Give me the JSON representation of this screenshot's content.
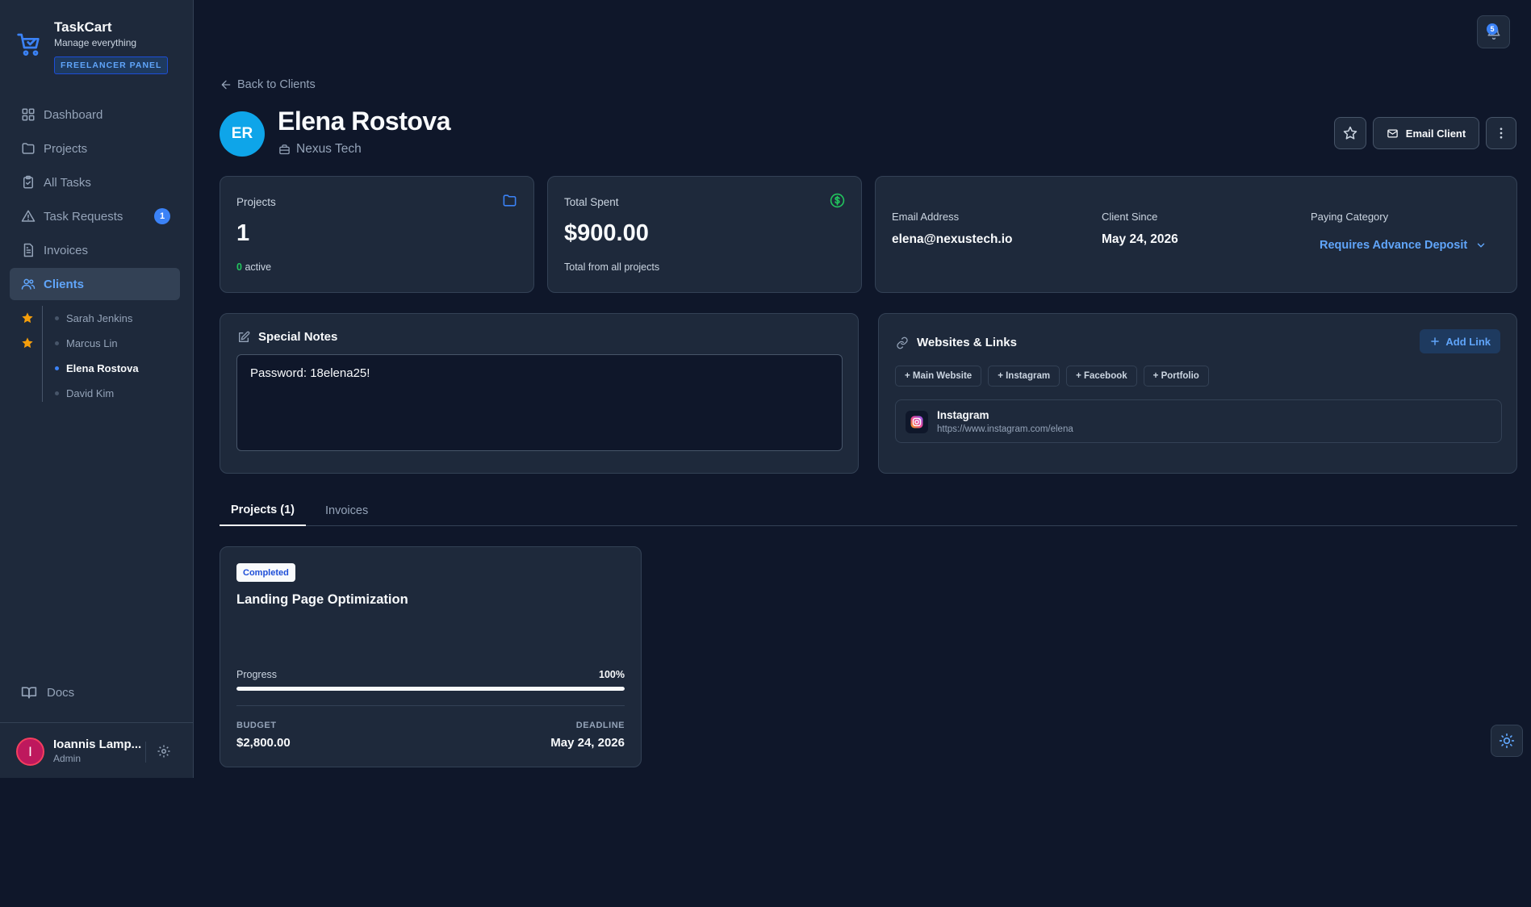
{
  "brand": {
    "name": "TaskCart",
    "subtitle": "Manage everything",
    "badge": "FREELANCER PANEL"
  },
  "nav": {
    "items": [
      {
        "label": "Dashboard",
        "icon": "grid-icon"
      },
      {
        "label": "Projects",
        "icon": "folder-icon"
      },
      {
        "label": "All Tasks",
        "icon": "clipboard-check-icon"
      },
      {
        "label": "Task Requests",
        "icon": "alert-triangle-icon",
        "badge": "1"
      },
      {
        "label": "Invoices",
        "icon": "file-text-icon"
      },
      {
        "label": "Clients",
        "icon": "users-icon",
        "active": true
      }
    ],
    "clients": [
      {
        "label": "Sarah Jenkins",
        "starred": true
      },
      {
        "label": "Marcus Lin",
        "starred": true
      },
      {
        "label": "Elena Rostova",
        "active": true
      },
      {
        "label": "David Kim"
      }
    ],
    "docs_label": "Docs"
  },
  "user": {
    "initial": "I",
    "name": "Ioannis Lamp...",
    "role": "Admin"
  },
  "notifications": {
    "count": "5"
  },
  "header": {
    "back_label": "Back to Clients",
    "avatar_initials": "ER",
    "client_name": "Elena Rostova",
    "company": "Nexus Tech",
    "email_button": "Email Client"
  },
  "stats": {
    "projects": {
      "label": "Projects",
      "value": "1",
      "active_count": "0",
      "active_suffix": "active"
    },
    "total_spent": {
      "label": "Total Spent",
      "value": "$900.00",
      "sub": "Total from all projects"
    }
  },
  "info": {
    "email_label": "Email Address",
    "email_value": "elena@nexustech.io",
    "since_label": "Client Since",
    "since_value": "May 24, 2026",
    "category_label": "Paying Category",
    "category_value": "Requires Advance Deposit"
  },
  "notes": {
    "title": "Special Notes",
    "value": "Password: 18elena25!"
  },
  "links": {
    "title": "Websites & Links",
    "add_label": "Add Link",
    "chips": [
      "+ Main Website",
      "+ Instagram",
      "+ Facebook",
      "+ Portfolio"
    ],
    "items": [
      {
        "name": "Instagram",
        "url": "https://www.instagram.com/elena"
      }
    ]
  },
  "tabs": [
    {
      "label": "Projects (1)",
      "active": true
    },
    {
      "label": "Invoices"
    }
  ],
  "project": {
    "status": "Completed",
    "title": "Landing Page Optimization",
    "progress_label": "Progress",
    "progress_text": "100%",
    "progress": 1.0,
    "budget_label": "BUDGET",
    "budget_value": "$2,800.00",
    "deadline_label": "DEADLINE",
    "deadline_value": "May 24, 2026"
  },
  "colors": {
    "background": "#0f172a",
    "surface": "#1e293b",
    "accent": "#3b82f6",
    "success": "#22c55e",
    "star": "#f59e0b"
  }
}
